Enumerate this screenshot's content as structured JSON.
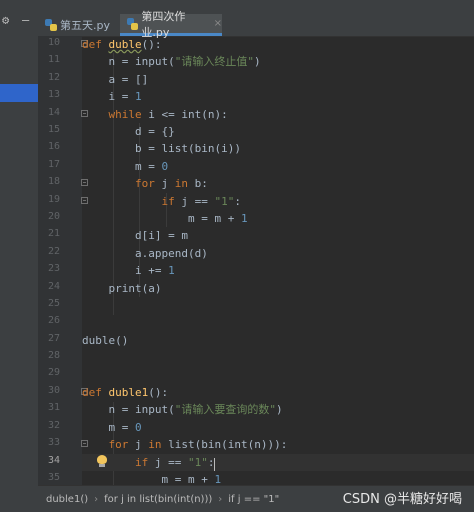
{
  "tabs": [
    {
      "label": "第五天.py",
      "active": false
    },
    {
      "label": "第四次作业.py",
      "active": true
    }
  ],
  "icons": {
    "settings": "⚙",
    "minimize": "—",
    "close_tab": "×"
  },
  "line_numbers": [
    "10",
    "11",
    "12",
    "13",
    "14",
    "15",
    "16",
    "17",
    "18",
    "19",
    "20",
    "21",
    "22",
    "23",
    "24",
    "25",
    "26",
    "27",
    "28",
    "29",
    "30",
    "31",
    "32",
    "33",
    "34",
    "35"
  ],
  "current_line": "34",
  "code_lines": [
    "def duble():",
    "    n = input(\"请输入终止值\")",
    "    a = []",
    "    i = 1",
    "    while i <= int(n):",
    "        d = {}",
    "        b = list(bin(i))",
    "        m = 0",
    "        for j in b:",
    "            if j == \"1\":",
    "                m = m + 1",
    "        d[i] = m",
    "        a.append(d)",
    "        i += 1",
    "    print(a)",
    "",
    "",
    "duble()",
    "",
    "",
    "def duble1():",
    "    n = input(\"请输入要查询的数\")",
    "    m = 0",
    "    for j in list(bin(int(n))):",
    "        if j == \"1\":",
    "            m = m + 1"
  ],
  "breadcrumbs": [
    "duble1()",
    "for j in list(bin(int(n)))",
    "if j == \"1\""
  ],
  "watermark": "CSDN @半糖好好喝",
  "colors": {
    "keyword": "#cc7832",
    "function": "#ffc66d",
    "number": "#6897bb",
    "string": "#6a8759",
    "text": "#a9b7c6",
    "background": "#2b2b2b"
  }
}
